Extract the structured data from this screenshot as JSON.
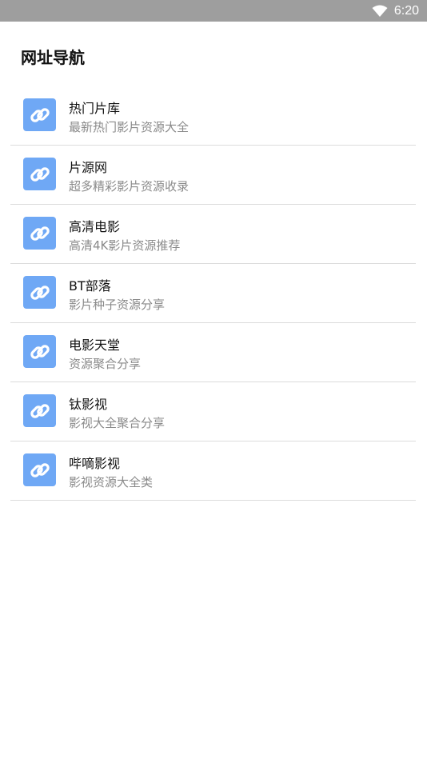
{
  "status_bar": {
    "time": "6:20",
    "icons": [
      "wifi-icon"
    ]
  },
  "page": {
    "title": "网址导航"
  },
  "links": [
    {
      "name": "热门片库",
      "desc": "最新热门影片资源大全",
      "icon": "link-icon"
    },
    {
      "name": "片源网",
      "desc": "超多精彩影片资源收录",
      "icon": "link-icon"
    },
    {
      "name": "高清电影",
      "desc": "高清4K影片资源推荐",
      "icon": "link-icon"
    },
    {
      "name": "BT部落",
      "desc": "影片种子资源分享",
      "icon": "link-icon"
    },
    {
      "name": "电影天堂",
      "desc": "资源聚合分享",
      "icon": "link-icon"
    },
    {
      "name": "钛影视",
      "desc": "影视大全聚合分享",
      "icon": "link-icon"
    },
    {
      "name": "哔嘀影视",
      "desc": "影视资源大全类",
      "icon": "link-icon"
    }
  ],
  "colors": {
    "status_bar_bg": "#9e9e9e",
    "icon_bg": "#6fa8f5",
    "title_text": "#111111",
    "desc_text": "#8a8a8a",
    "divider": "#dcdcdc"
  }
}
